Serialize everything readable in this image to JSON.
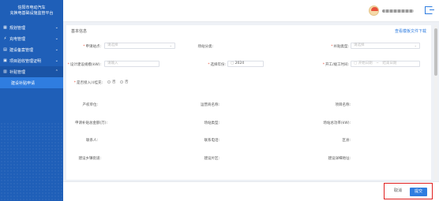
{
  "brand": {
    "line1": "信阳市电动汽车",
    "line2": "充换电基础设施监管平台"
  },
  "sidebar": {
    "items": [
      {
        "label": "规划管理",
        "icon": "plan-icon"
      },
      {
        "label": "充电管理",
        "icon": "charge-icon"
      },
      {
        "label": "建设备案管理",
        "icon": "filing-icon"
      },
      {
        "label": "项目验收管理证明",
        "icon": "acceptance-icon"
      },
      {
        "label": "补贴管理",
        "icon": "subsidy-icon"
      }
    ],
    "sub_item": "建设补贴申请"
  },
  "header": {
    "user_label": ""
  },
  "form": {
    "section_title": "基本信息",
    "download_link": "查看模板文件下载",
    "row1": {
      "apply_site_label": "申请站点:",
      "apply_site_placeholder": "请选择",
      "site_type_label": "场站分类:",
      "subsidy_type_label": "补贴类型:",
      "subsidy_type_placeholder": "请选择"
    },
    "row2": {
      "power_label": "设计建设规模(kW):",
      "power_placeholder": "请输入",
      "year_label": "选择年份:",
      "year_value": "2024",
      "date_label": "开工/竣工时间:",
      "date_start_placeholder": "开始日期",
      "date_sep": "~",
      "date_end_placeholder": "结束日期"
    },
    "row3": {
      "wall_label": "是否接入川桂充:",
      "opt_no": "否",
      "opt_yes": "否"
    },
    "static": {
      "owner": "产权单位:",
      "operator": "运营商名称:",
      "project_name": "项目名称:",
      "subsidy_total": "申请补贴总金额(万):",
      "station_type": "场站类型:",
      "station_power": "场站总功率(kW):",
      "contact": "联系人:",
      "phone": "联系电话:",
      "county": "区县:",
      "street": "建设乡镇街道:",
      "district": "建设片区:",
      "address": "建设详细地址:"
    }
  },
  "footer": {
    "cancel_label": "取消",
    "submit_label": "提交"
  },
  "colors": {
    "primary": "#2f7de0",
    "sidebar": "#1f5fb8",
    "required": "#e8503a",
    "highlight_border": "#e02020"
  }
}
